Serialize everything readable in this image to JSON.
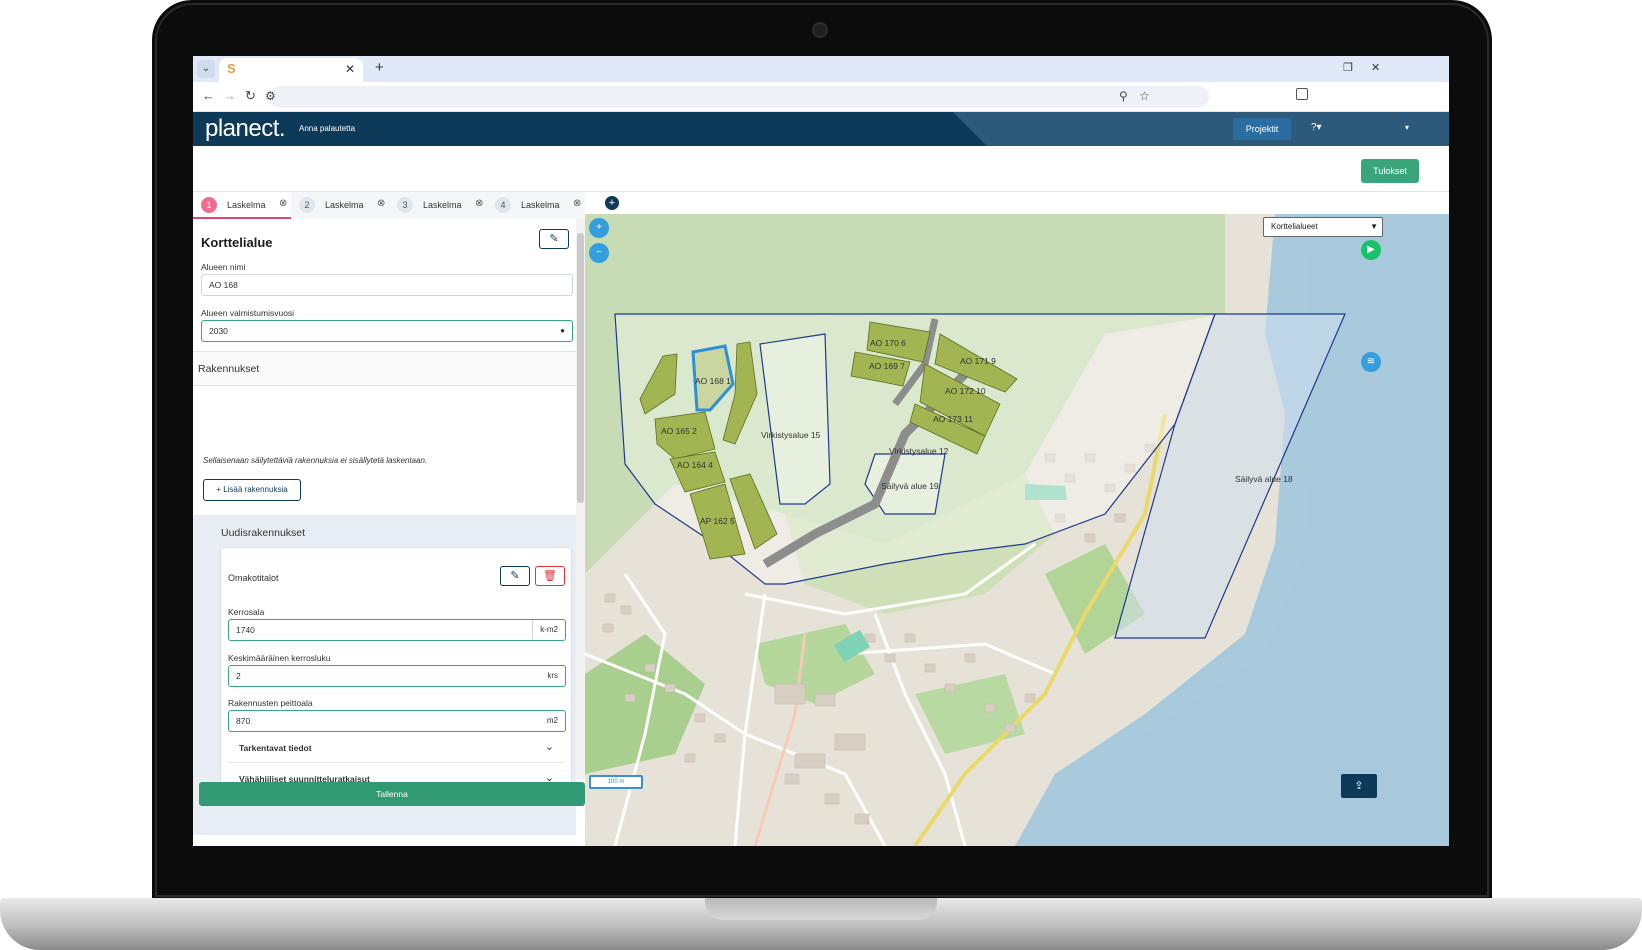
{
  "browser": {
    "favicon": "S",
    "tab_close": "✕",
    "new_tab": "+",
    "dropdown": "⌄"
  },
  "header": {
    "logo": "planect.",
    "feedback": "Anna palautetta",
    "projects_label": "Projektit",
    "help_label": "?▾",
    "user_dropdown": "▾"
  },
  "subbar": {
    "results_label": "Tulokset"
  },
  "calc_tabs": [
    {
      "num": "1",
      "label": "Laskelma",
      "active": true
    },
    {
      "num": "2",
      "label": "Laskelma",
      "active": false
    },
    {
      "num": "3",
      "label": "Laskelma",
      "active": false
    },
    {
      "num": "4",
      "label": "Laskelma",
      "active": false
    }
  ],
  "panel": {
    "title": "Korttelialue",
    "area_name_label": "Alueen nimi",
    "area_name_value": "AO 168",
    "year_label": "Alueen valmistumisvuosi",
    "year_value": "2030",
    "buildings_title": "Rakennukset",
    "buildings_note": "Sellaisenaan säilytettäviä rakennuksia ei sisällytetä laskentaan.",
    "add_buildings_label": "+  Lisää rakennuksia",
    "new_buildings_title": "Uudisrakennukset",
    "card": {
      "title": "Omakotitalot",
      "floor_area_label": "Kerrosala",
      "floor_area_value": "1740",
      "floor_area_unit": "k-m2",
      "floors_label": "Keskimääräinen kerrosluku",
      "floors_value": "2",
      "floors_unit": "krs",
      "footprint_label": "Rakennusten peittoala",
      "footprint_value": "870",
      "footprint_unit": "m2",
      "accordion": [
        "Tarkentavat tiedot",
        "Vähähiiliset suunnitteluratkaisut"
      ]
    },
    "save_label": "Tallenna"
  },
  "map": {
    "layer_select": "Korttelialueet",
    "scale_label": "100 m",
    "area_labels": [
      "AO 168 1",
      "AO 170 6",
      "AO 171 9",
      "AO 169 7",
      "AO 172 10",
      "AO 173 11",
      "AO 165 2",
      "AO 164 4",
      "AP 162 5",
      "Virkistysalue 15",
      "Virkistysalue 12",
      "Säilyvä alue 19",
      "Säilyvä alue 18"
    ]
  },
  "colors": {
    "header_bg": "#0e3a5a",
    "primary_green": "#2f9a73",
    "active_tab": "#e0467a",
    "block_fill": "#a3b553",
    "map_accent": "#33a0dd"
  }
}
